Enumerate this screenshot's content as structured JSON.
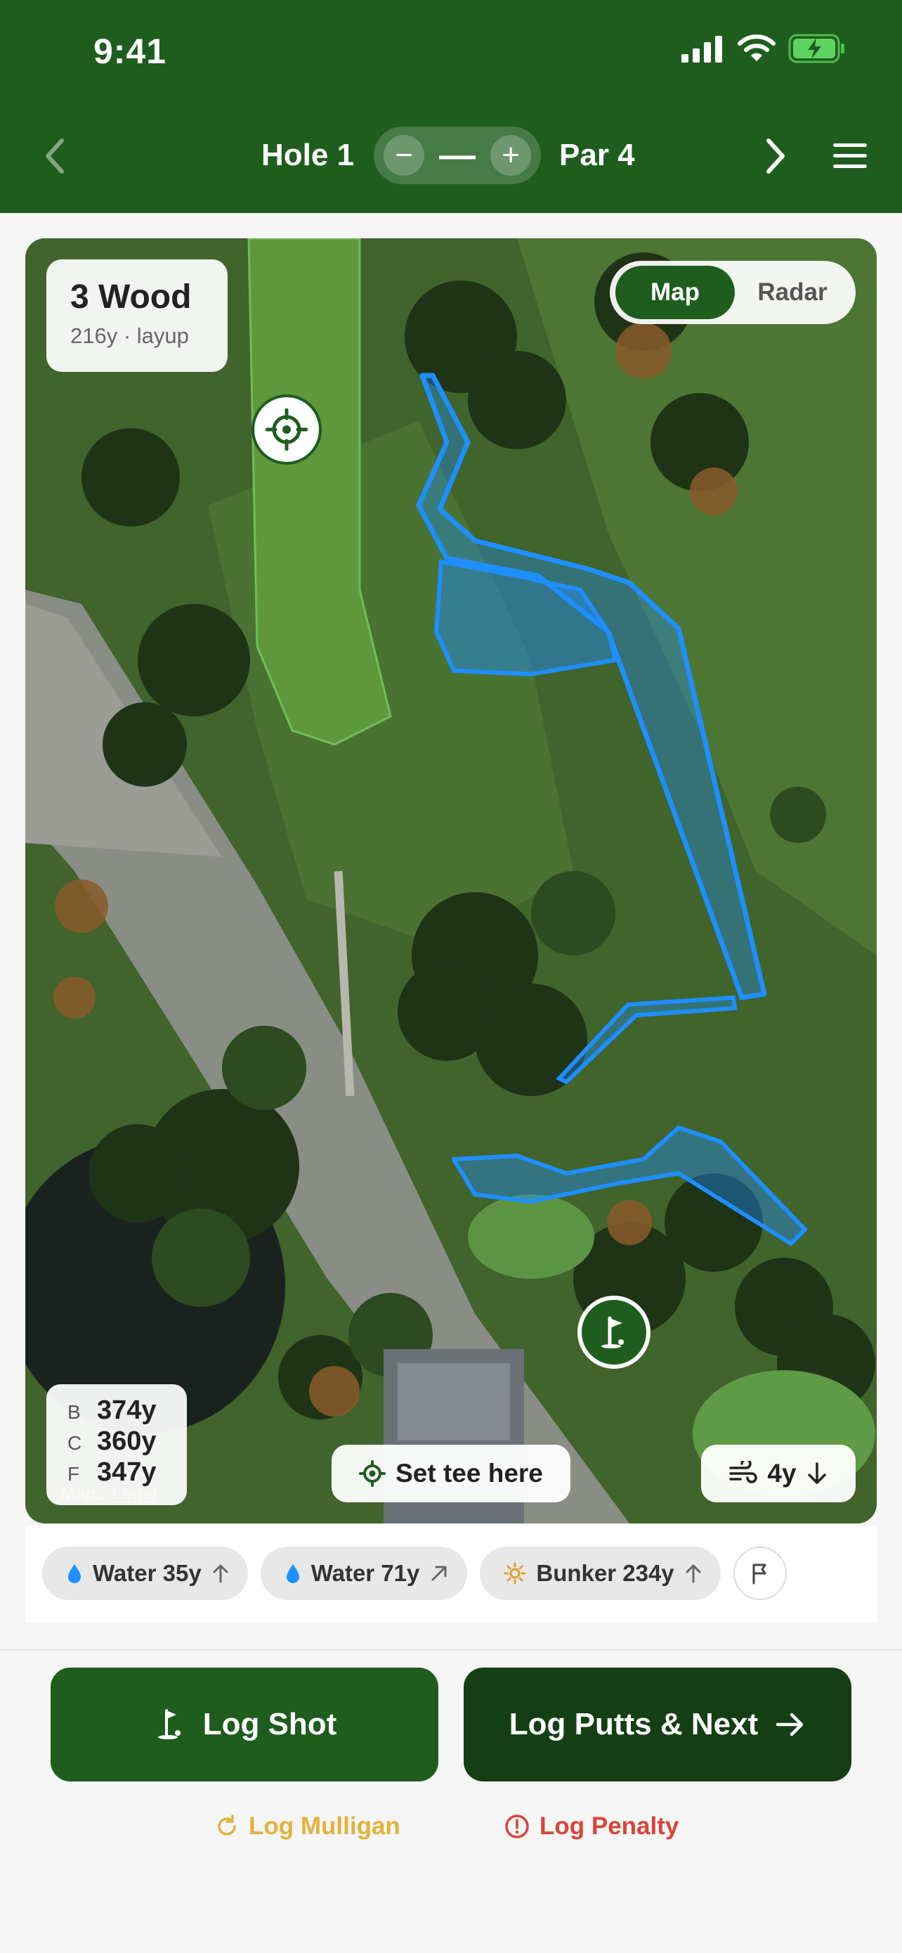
{
  "status_bar": {
    "time": "9:41"
  },
  "header": {
    "hole_label": "Hole 1",
    "stroke_display": "—",
    "decrement_symbol": "−",
    "increment_symbol": "+",
    "par_label": "Par 4",
    "color": "#1e5d1e"
  },
  "club": {
    "name": "3 Wood",
    "detail": "216y · layup"
  },
  "map_toggle": {
    "active": "Map",
    "inactive": "Radar"
  },
  "yardages": [
    {
      "key": "B",
      "value": "374y"
    },
    {
      "key": "C",
      "value": "360y"
    },
    {
      "key": "F",
      "value": "347y"
    }
  ],
  "map_attribution": {
    "brand": "Maps",
    "legal": "Legal"
  },
  "set_tee_label": "Set tee here",
  "wind": {
    "label": "4y",
    "direction": "down"
  },
  "hazards": [
    {
      "icon": "water-drop-icon",
      "label": "Water 35y",
      "arrow": "up"
    },
    {
      "icon": "water-drop-icon",
      "label": "Water 71y",
      "arrow": "up-right"
    },
    {
      "icon": "bunker-sun-icon",
      "label": "Bunker 234y",
      "arrow": "up"
    }
  ],
  "actions": {
    "log_shot": "Log Shot",
    "log_putts_next": "Log Putts & Next",
    "log_mulligan": "Log Mulligan",
    "log_penalty": "Log Penalty"
  },
  "colors": {
    "primary_green": "#1e5d1e",
    "dark_green": "#143f14",
    "water_blue": "#1e8fff",
    "mulligan": "#e3b23c",
    "penalty": "#d9443a"
  }
}
